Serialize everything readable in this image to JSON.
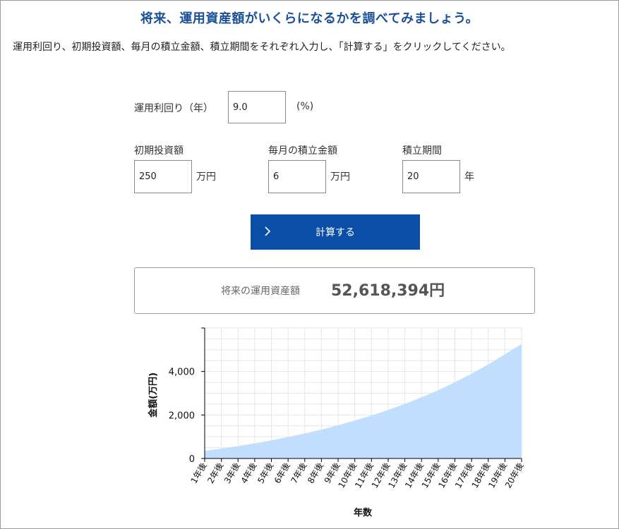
{
  "header": {
    "title": "将来、運用資産額がいくらになるかを調べてみましょう。",
    "description": "運用利回り、初期投資額、毎月の積立金額、積立期間をそれぞれ入力し、「計算する」をクリックしてください。"
  },
  "form": {
    "rate": {
      "label": "運用利回り（年）",
      "value": "9.0",
      "unit": "(%)"
    },
    "initial": {
      "label": "初期投資額",
      "value": "250",
      "unit": "万円"
    },
    "monthly": {
      "label": "毎月の積立金額",
      "value": "6",
      "unit": "万円"
    },
    "period": {
      "label": "積立期間",
      "value": "20",
      "unit": "年"
    }
  },
  "calculate_button": {
    "label": "計算する",
    "icon": "chevron-right-icon"
  },
  "result": {
    "label": "将来の運用資産額",
    "value": "52,618,394円"
  },
  "colors": {
    "title": "#1a5099",
    "button": "#0a4ea8",
    "area_fill": "#c2deff"
  },
  "chart_data": {
    "type": "area",
    "xlabel": "年数",
    "ylabel": "金額(万円)",
    "x": [
      "1年後",
      "2年後",
      "3年後",
      "4年後",
      "5年後",
      "6年後",
      "7年後",
      "8年後",
      "9年後",
      "10年後",
      "11年後",
      "12年後",
      "13年後",
      "14年後",
      "15年後",
      "16年後",
      "17年後",
      "18年後",
      "19年後",
      "20年後"
    ],
    "values": [
      347,
      453,
      569,
      696,
      835,
      986,
      1151,
      1331,
      1527,
      1741,
      1975,
      2230,
      2508,
      2811,
      3141,
      3502,
      3895,
      4323,
      4790,
      5262
    ],
    "ylim": [
      0,
      6000
    ],
    "yticks": [
      0,
      2000,
      4000
    ],
    "ytick_labels": [
      "0",
      "2,000",
      "4,000"
    ],
    "grid": true,
    "legend": "none"
  }
}
